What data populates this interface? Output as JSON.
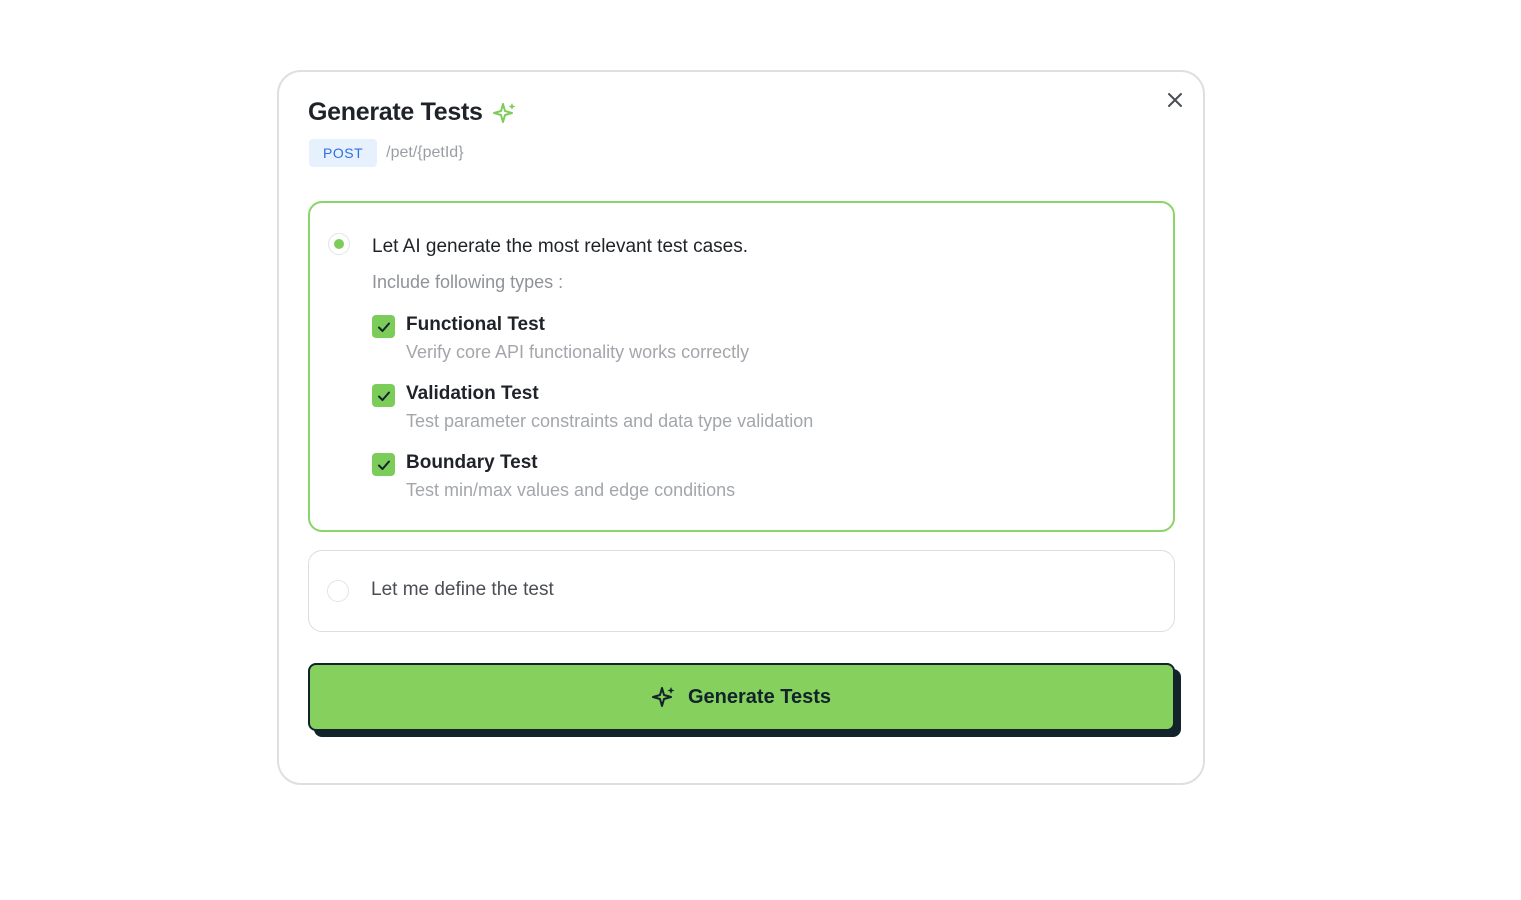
{
  "modal": {
    "title": "Generate Tests",
    "method": "POST",
    "endpoint": "/pet/{petId}",
    "accent_color": "#86d05d",
    "icons": {
      "title": "sparkle-icon",
      "close": "close-icon"
    }
  },
  "options": {
    "ai": {
      "label": "Let AI generate the most relevant test cases.",
      "selected": true,
      "include_label": "Include following types :",
      "types": [
        {
          "name": "Functional Test",
          "description": "Verify core API functionality works correctly",
          "checked": true
        },
        {
          "name": "Validation Test",
          "description": "Test parameter constraints and data type validation",
          "checked": true
        },
        {
          "name": "Boundary Test",
          "description": "Test min/max values and edge conditions",
          "checked": true
        }
      ]
    },
    "manual": {
      "label": "Let me define the test",
      "selected": false
    }
  },
  "actions": {
    "generate_label": "Generate Tests",
    "generate_icon": "sparkle-icon"
  }
}
